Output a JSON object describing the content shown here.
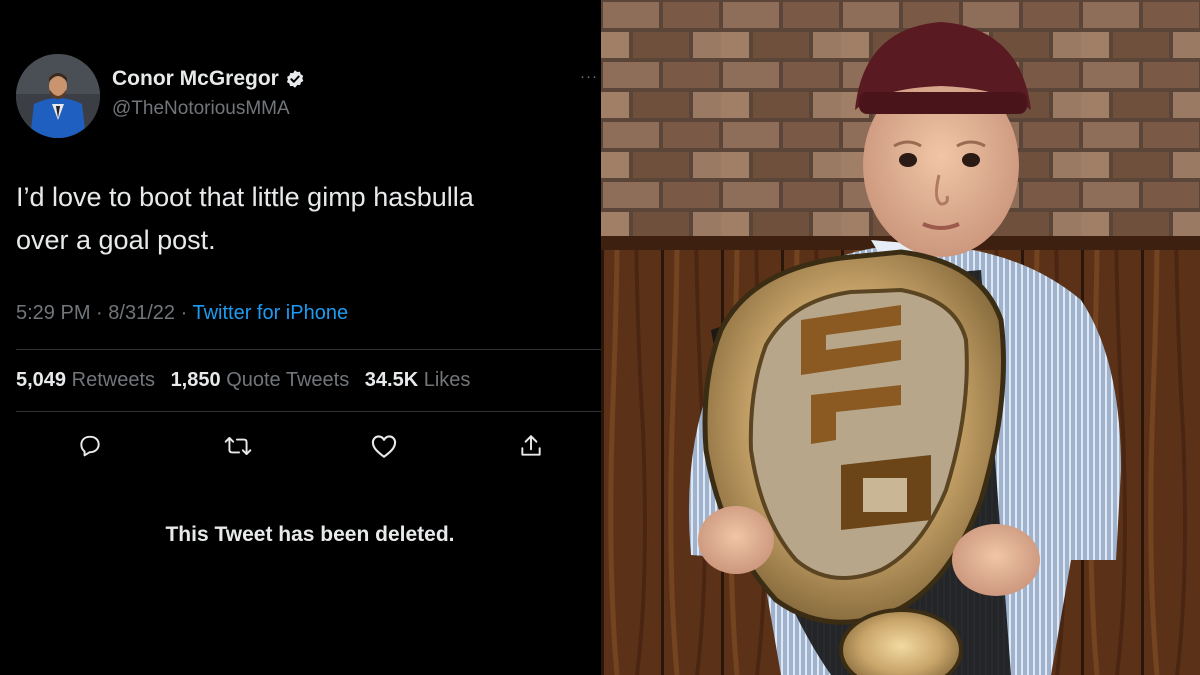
{
  "tweet": {
    "author": {
      "name": "Conor McGregor",
      "handle": "@TheNotoriousMMA",
      "verified": true,
      "avatar_icon": "avatar-icon"
    },
    "more_label": "···",
    "text_line1": "I’d love to boot that little gimp hasbulla",
    "text_line2": "over a goal post.",
    "time": "5:29 PM",
    "separator": "·",
    "date": "8/31/22",
    "source": "Twitter for iPhone",
    "stats": {
      "retweets_count": "5,049",
      "retweets_label": "Retweets",
      "quotes_count": "1,850",
      "quotes_label": "Quote Tweets",
      "likes_count": "34.5K",
      "likes_label": "Likes"
    },
    "actions": [
      "reply-icon",
      "retweet-icon",
      "like-icon",
      "share-icon"
    ],
    "deleted_notice": "This Tweet has been deleted."
  },
  "colors": {
    "background": "#000000",
    "text": "#e7e9ea",
    "muted": "#71767b",
    "link": "#1d9bf0",
    "verified_badge": "#e7e9ea"
  }
}
